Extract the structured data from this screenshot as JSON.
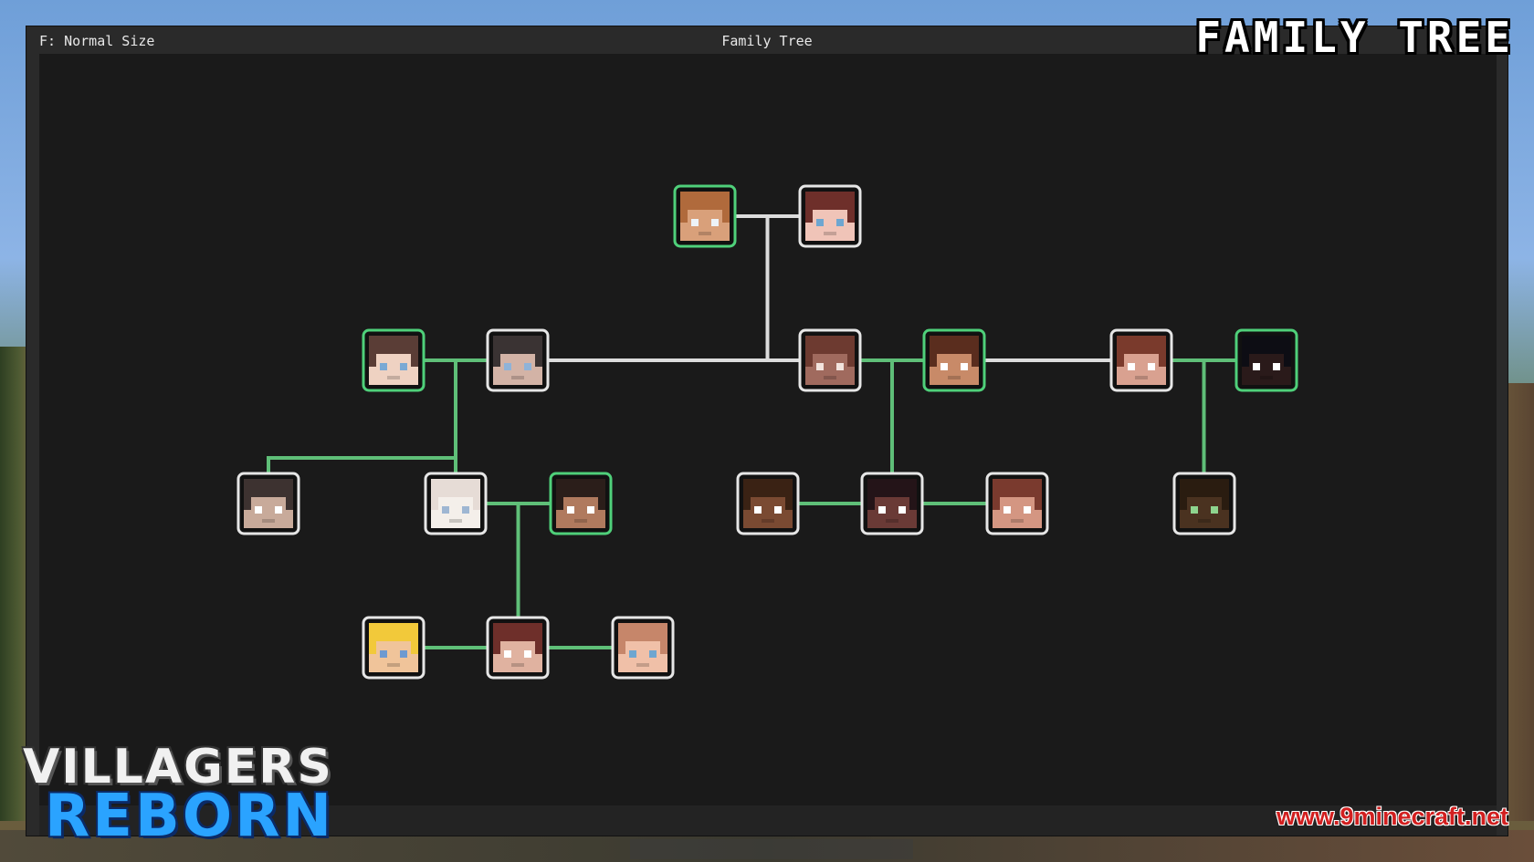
{
  "window": {
    "hint": "F: Normal Size",
    "title": "Family Tree"
  },
  "banner": {
    "corner_title": "FAMILY TREE",
    "logo_line1": "VILLAGERS",
    "logo_line2": "REBORN",
    "watermark": "www.9minecraft.net"
  },
  "colors": {
    "male_border": "#4fd07a",
    "female_border": "#e6e6e6",
    "link_blood": "#5fbf78",
    "link_marriage": "#dcdcdc",
    "canvas": "#1a1a1a"
  },
  "tree": {
    "members": [
      {
        "id": "p1",
        "gender": "male",
        "skin": "#d9a07a",
        "hair": "#b06a3c",
        "eyes": "#eef3f7"
      },
      {
        "id": "p2",
        "gender": "female",
        "skin": "#f0c4b8",
        "hair": "#6e2f2a",
        "eyes": "#6ea6d0"
      },
      {
        "id": "c1",
        "gender": "male",
        "skin": "#efd2c2",
        "hair": "#5a3d36",
        "eyes": "#7aa9d4"
      },
      {
        "id": "c2",
        "gender": "female",
        "skin": "#d3b3a6",
        "hair": "#3a3333",
        "eyes": "#8fb3d8"
      },
      {
        "id": "c3",
        "gender": "female",
        "skin": "#a06a5e",
        "hair": "#6d3a30",
        "eyes": "#f2e4de"
      },
      {
        "id": "c4",
        "gender": "male",
        "skin": "#c88a68",
        "hair": "#5a2d1e",
        "eyes": "#ffffff"
      },
      {
        "id": "c5",
        "gender": "female",
        "skin": "#d9a190",
        "hair": "#7a3a2c",
        "eyes": "#ffffff"
      },
      {
        "id": "c6",
        "gender": "male",
        "skin": "#2a1a1a",
        "hair": "#0d0d14",
        "eyes": "#ffffff"
      },
      {
        "id": "g1",
        "gender": "female",
        "skin": "#c8aa9a",
        "hair": "#3d3230",
        "eyes": "#ffffff"
      },
      {
        "id": "g2",
        "gender": "female",
        "skin": "#f4efea",
        "hair": "#e6dcd6",
        "eyes": "#9eb6d2"
      },
      {
        "id": "g3",
        "gender": "male",
        "skin": "#b07a5e",
        "hair": "#2b1e1a",
        "eyes": "#ffffff"
      },
      {
        "id": "g4",
        "gender": "female",
        "skin": "#7a4a32",
        "hair": "#3a2214",
        "eyes": "#ffffff"
      },
      {
        "id": "g5",
        "gender": "female",
        "skin": "#6a3a36",
        "hair": "#241418",
        "eyes": "#ffffff"
      },
      {
        "id": "g6",
        "gender": "female",
        "skin": "#d49682",
        "hair": "#7a3a2e",
        "eyes": "#ffffff"
      },
      {
        "id": "g7",
        "gender": "female",
        "skin": "#4a3220",
        "hair": "#2a1c10",
        "eyes": "#8ed48e"
      },
      {
        "id": "k1",
        "gender": "female",
        "skin": "#f0c49a",
        "hair": "#f2c93a",
        "eyes": "#6e9ad0"
      },
      {
        "id": "k2",
        "gender": "female",
        "skin": "#e0b2a0",
        "hair": "#6e2f2a",
        "eyes": "#ffffff"
      },
      {
        "id": "k3",
        "gender": "female",
        "skin": "#f0c0a8",
        "hair": "#c6866a",
        "eyes": "#6ea6d0"
      }
    ]
  }
}
